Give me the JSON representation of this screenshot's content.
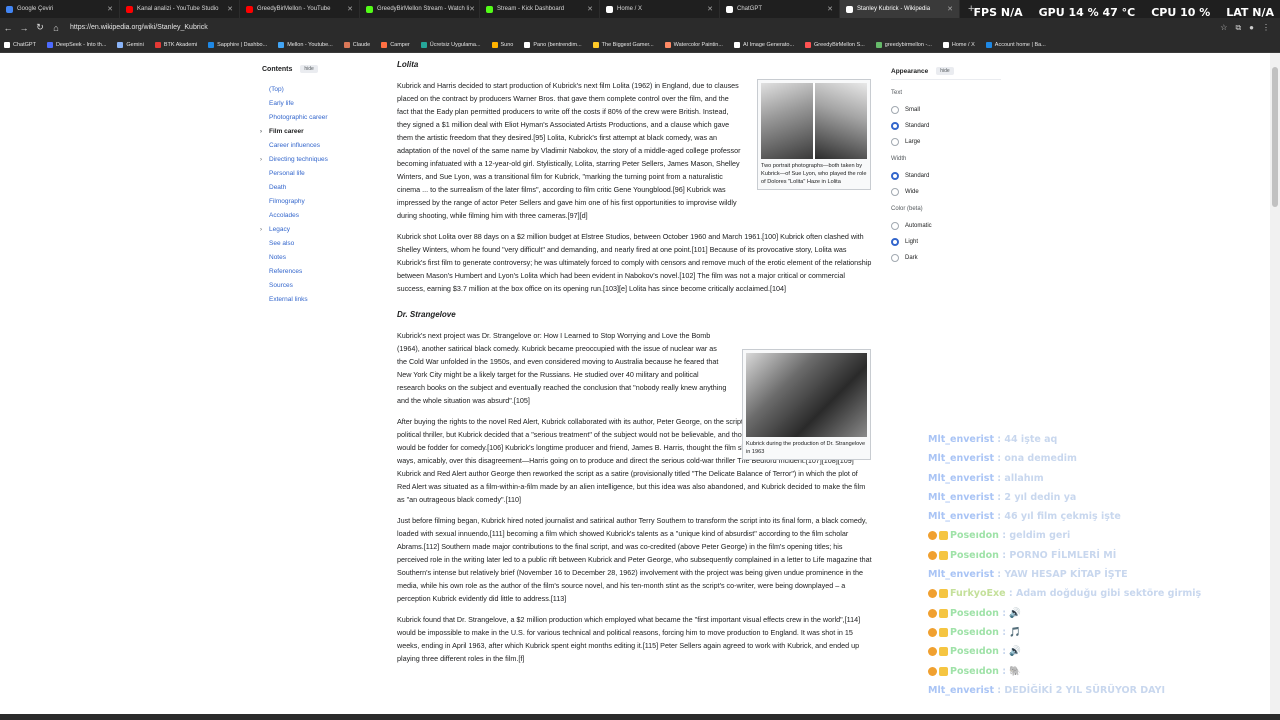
{
  "tabs": [
    {
      "label": "Google Çeviri",
      "color": "#4285f4"
    },
    {
      "label": "Kanal analizi - YouTube Studio",
      "color": "#ff0000"
    },
    {
      "label": "GreedyBirMellon - YouTube",
      "color": "#ff0000"
    },
    {
      "label": "GreedyBirMellon Stream - Watch li",
      "color": "#53fc18"
    },
    {
      "label": "Stream - Kick Dashboard",
      "color": "#53fc18"
    },
    {
      "label": "Home / X",
      "color": "#ffffff"
    },
    {
      "label": "ChatGPT",
      "color": "#ffffff"
    },
    {
      "label": "Stanley Kubrick - Wikipedia",
      "color": "#ffffff"
    }
  ],
  "stats": {
    "fps": "FPS  N/A",
    "gpu": "GPU 14 %  47 °C",
    "cpu": "CPU 10 %",
    "lat": "LAT  N/A"
  },
  "url": "https://en.wikipedia.org/wiki/Stanley_Kubrick",
  "bookmarks": [
    {
      "label": "ChatGPT",
      "color": "#ffffff"
    },
    {
      "label": "DeepSeek - Into th...",
      "color": "#4d6bfe"
    },
    {
      "label": "Gemini",
      "color": "#8ab4f8"
    },
    {
      "label": "BTK Akademi",
      "color": "#e53935"
    },
    {
      "label": "Sapphire | Dashbo...",
      "color": "#1e88e5"
    },
    {
      "label": "Mellon - Youtube...",
      "color": "#42a5f5"
    },
    {
      "label": "Claude",
      "color": "#d97757"
    },
    {
      "label": "Camper",
      "color": "#ff7043"
    },
    {
      "label": "Ücretsiz Uygulama...",
      "color": "#26a69a"
    },
    {
      "label": "Suno",
      "color": "#ffb300"
    },
    {
      "label": "Pano (bentrendim...",
      "color": "#ffffff"
    },
    {
      "label": "The Biggest Gamer...",
      "color": "#ffca28"
    },
    {
      "label": "Watercolor Paintin...",
      "color": "#ff8a65"
    },
    {
      "label": "AI Image Generato...",
      "color": "#ffffff"
    },
    {
      "label": "GreedyBirMellon S...",
      "color": "#ff5252"
    },
    {
      "label": "greedybirmellon -...",
      "color": "#66bb6a"
    },
    {
      "label": "Home / X",
      "color": "#ffffff"
    },
    {
      "label": "Account home | Ba...",
      "color": "#1e88e5"
    }
  ],
  "toc": {
    "title": "Contents",
    "hide": "hide",
    "items": [
      {
        "label": "(Top)",
        "arrow": ""
      },
      {
        "label": "Early life",
        "arrow": ""
      },
      {
        "label": "Photographic career",
        "arrow": ""
      },
      {
        "label": "Film career",
        "arrow": "›",
        "current": true
      },
      {
        "label": "Career influences",
        "arrow": ""
      },
      {
        "label": "Directing techniques",
        "arrow": "›"
      },
      {
        "label": "Personal life",
        "arrow": ""
      },
      {
        "label": "Death",
        "arrow": ""
      },
      {
        "label": "Filmography",
        "arrow": ""
      },
      {
        "label": "Accolades",
        "arrow": ""
      },
      {
        "label": "Legacy",
        "arrow": "›"
      },
      {
        "label": "See also",
        "arrow": ""
      },
      {
        "label": "Notes",
        "arrow": ""
      },
      {
        "label": "References",
        "arrow": ""
      },
      {
        "label": "Sources",
        "arrow": ""
      },
      {
        "label": "External links",
        "arrow": ""
      }
    ]
  },
  "article": {
    "h_lolita": "Lolita",
    "p1": "Kubrick and Harris decided to start production of Kubrick's next film Lolita (1962) in England, due to clauses placed on the contract by producers Warner Bros. that gave them complete control over the film, and the fact that the Eady plan permitted producers to write off the costs if 80% of the crew were British. Instead, they signed a $1 million deal with Eliot Hyman's Associated Artists Productions, and a clause which gave them the artistic freedom that they desired.[95] Lolita, Kubrick's first attempt at black comedy, was an adaptation of the novel of the same name by Vladimir Nabokov, the story of a middle-aged college professor becoming infatuated with a 12-year-old girl. Stylistically, Lolita, starring Peter Sellers, James Mason, Shelley Winters, and Sue Lyon, was a transitional film for Kubrick, \"marking the turning point from a naturalistic cinema ... to the surrealism of the later films\", according to film critic Gene Youngblood.[96] Kubrick was impressed by the range of actor Peter Sellers and gave him one of his first opportunities to improvise wildly during shooting, while filming him with three cameras.[97][d]",
    "p2": "Kubrick shot Lolita over 88 days on a $2 million budget at Elstree Studios, between October 1960 and March 1961.[100] Kubrick often clashed with Shelley Winters, whom he found \"very difficult\" and demanding, and nearly fired at one point.[101] Because of its provocative story, Lolita was Kubrick's first film to generate controversy; he was ultimately forced to comply with censors and remove much of the erotic element of the relationship between Mason's Humbert and Lyon's Lolita which had been evident in Nabokov's novel.[102] The film was not a major critical or commercial success, earning $3.7 million at the box office on its opening run.[103][e] Lolita has since become critically acclaimed.[104]",
    "h_strangelove": "Dr. Strangelove",
    "p3": "Kubrick's next project was Dr. Strangelove or: How I Learned to Stop Worrying and Love the Bomb (1964), another satirical black comedy. Kubrick became preoccupied with the issue of nuclear war as the Cold War unfolded in the 1950s, and even considered moving to Australia because he feared that New York City might be a likely target for the Russians. He studied over 40 military and political research books on the subject and eventually reached the conclusion that \"nobody really knew anything and the whole situation was absurd\".[105]",
    "p4": "After buying the rights to the novel Red Alert, Kubrick collaborated with its author, Peter George, on the script. It was originally written as a serious political thriller, but Kubrick decided that a \"serious treatment\" of the subject would not be believable, and thought that some of its most salient points would be fodder for comedy.[106] Kubrick's longtime producer and friend, James B. Harris, thought the film should be serious, and the two parted ways, amicably, over this disagreement—Harris going on to produce and direct the serious cold-war thriller The Bedford Incident.[107][108][109] Kubrick and Red Alert author George then reworked the script as a satire (provisionally titled \"The Delicate Balance of Terror\") in which the plot of Red Alert was situated as a film-within-a-film made by an alien intelligence, but this idea was also abandoned, and Kubrick decided to make the film as \"an outrageous black comedy\".[110]",
    "p5": "Just before filming began, Kubrick hired noted journalist and satirical author Terry Southern to transform the script into its final form, a black comedy, loaded with sexual innuendo,[111] becoming a film which showed Kubrick's talents as a \"unique kind of absurdist\" according to the film scholar Abrams.[112] Southern made major contributions to the final script, and was co-credited (above Peter George) in the film's opening titles; his perceived role in the writing later led to a public rift between Kubrick and Peter George, who subsequently complained in a letter to Life magazine that Southern's intense but relatively brief (November 16 to December 28, 1962) involvement with the project was being given undue prominence in the media, while his own role as the author of the film's source novel, and his ten-month stint as the script's co-writer, were being downplayed – a perception Kubrick evidently did little to address.[113]",
    "p6": "Kubrick found that Dr. Strangelove, a $2 million production which employed what became the \"first important visual effects crew in the world\",[114] would be impossible to make in the U.S. for various technical and political reasons, forcing him to move production to England. It was shot in 15 weeks, ending in April 1963, after which Kubrick spent eight months editing it.[115] Peter Sellers again agreed to work with Kubrick, and ended up playing three different roles in the film.[f]",
    "fig1_caption": "Two portrait photographs—both taken by Kubrick—of Sue Lyon, who played the role of Dolores \"Lolita\" Haze in Lolita",
    "fig2_caption": "Kubrick during the production of Dr. Strangelove in 1963"
  },
  "appearance": {
    "title": "Appearance",
    "hide": "hide",
    "text_label": "Text",
    "text_options": [
      {
        "label": "Small",
        "on": false
      },
      {
        "label": "Standard",
        "on": true
      },
      {
        "label": "Large",
        "on": false
      }
    ],
    "width_label": "Width",
    "width_options": [
      {
        "label": "Standard",
        "on": true
      },
      {
        "label": "Wide",
        "on": false
      }
    ],
    "color_label": "Color (beta)",
    "color_options": [
      {
        "label": "Automatic",
        "on": false
      },
      {
        "label": "Light",
        "on": true
      },
      {
        "label": "Dark",
        "on": false
      }
    ]
  },
  "chat": [
    {
      "user": "Mlt_enverist",
      "sep": " : ",
      "text": "44 işte aq",
      "ucolor": "#a9c4f5",
      "badge": false
    },
    {
      "user": "Mlt_enverist",
      "sep": " : ",
      "text": "ona demedim",
      "ucolor": "#a9c4f5",
      "badge": false
    },
    {
      "user": "Mlt_enverist",
      "sep": " : ",
      "text": "allahım",
      "ucolor": "#a9c4f5",
      "badge": false
    },
    {
      "user": "Mlt_enverist",
      "sep": " : ",
      "text": "2 yıl dedin ya",
      "ucolor": "#a9c4f5",
      "badge": false
    },
    {
      "user": "Mlt_enverist",
      "sep": " : ",
      "text": "46 yıl film çekmiş işte",
      "ucolor": "#a9c4f5",
      "badge": false
    },
    {
      "user": "Poseıdon",
      "sep": " : ",
      "text": "geldim geri",
      "ucolor": "#9fe2a8",
      "badge": true
    },
    {
      "user": "Poseıdon",
      "sep": " : ",
      "text": "PORNO FİLMLERİ Mİ",
      "ucolor": "#9fe2a8",
      "badge": true
    },
    {
      "user": "Mlt_enverist",
      "sep": " : ",
      "text": "YAW HESAP KİTAP İŞTE",
      "ucolor": "#a9c4f5",
      "badge": false
    },
    {
      "user": "FurkyoExe",
      "sep": " : ",
      "text": "Adam doğduğu gibi sektöre girmiş",
      "ucolor": "#c4e09a",
      "badge": true
    },
    {
      "user": "Poseıdon",
      "sep": " : ",
      "text": "🔊",
      "ucolor": "#9fe2a8",
      "badge": true
    },
    {
      "user": "Poseıdon",
      "sep": " : ",
      "text": "🎵",
      "ucolor": "#9fe2a8",
      "badge": true
    },
    {
      "user": "Poseıdon",
      "sep": " : ",
      "text": "🔊",
      "ucolor": "#9fe2a8",
      "badge": true
    },
    {
      "user": "Poseıdon",
      "sep": " : ",
      "text": "🐘",
      "ucolor": "#9fe2a8",
      "badge": true
    },
    {
      "user": "Mlt_enverist",
      "sep": " : ",
      "text": "DEDİĞİKİ 2 YIL SÜRÜYOR DAYI",
      "ucolor": "#a9c4f5",
      "badge": false
    }
  ]
}
